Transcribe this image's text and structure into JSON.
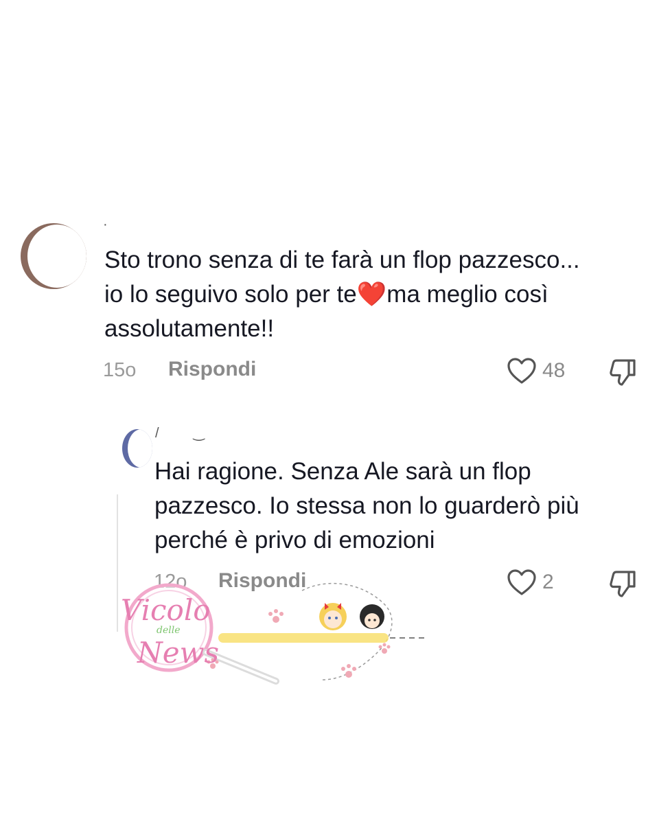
{
  "comments": [
    {
      "text": "Sto trono senza di te farà un flop pazzesco...\nio lo seguivo solo per te❤️ma meglio così\nassolutamente!!",
      "time": "15o",
      "reply_label": "Rispondi",
      "likes": "48"
    }
  ],
  "replies": [
    {
      "text": "Hai ragione. Senza Ale sarà un flop\npazzesco. Io stessa non lo guarderò più\nperché è privo di emozioni",
      "time": "12o",
      "reply_label": "Rispondi",
      "likes": "2"
    }
  ],
  "watermark": {
    "brand_line1": "Vicolo",
    "brand_line2": "delle",
    "brand_line3": "News"
  },
  "icons": {
    "like": "heart-outline-icon",
    "dislike": "thumbs-down-icon"
  },
  "colors": {
    "text": "#161823",
    "meta": "#8a8a8a",
    "heart_emoji": "#e8182c",
    "watermark_pink": "#e67fb1"
  }
}
